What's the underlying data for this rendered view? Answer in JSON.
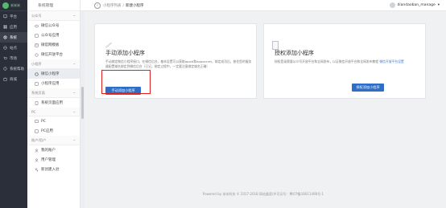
{
  "rail": {
    "logo": "米米米",
    "items": [
      {
        "label": "平台",
        "icon": "monitor-icon"
      },
      {
        "label": "应用",
        "icon": "grid-icon"
      },
      {
        "label": "系统",
        "icon": "gear-icon"
      },
      {
        "label": "站点",
        "icon": "globe-icon"
      },
      {
        "label": "市场",
        "icon": "cart-icon"
      },
      {
        "label": "系统帮助",
        "icon": "help-icon"
      },
      {
        "label": "商城",
        "icon": "shop-icon"
      }
    ]
  },
  "side": {
    "header": "系统管理",
    "groups": [
      {
        "label": "公众号",
        "items": [
          "微信公众号",
          "公众号应用",
          "微官网模板",
          "微信开放平台"
        ]
      },
      {
        "label": "小程序",
        "items": [
          "微信小程序",
          "小程序应用"
        ]
      },
      {
        "label": "系统页面",
        "items": [
          "系统页面应用"
        ]
      },
      {
        "label": "PC",
        "items": [
          "PC",
          "PC应用"
        ]
      },
      {
        "label": "账户/用户",
        "items": [
          "我的账户",
          "用户管理",
          "新创建入驻"
        ]
      }
    ]
  },
  "topbar": {
    "back": "‹",
    "crumb_parent": "小程序列表",
    "crumb_sep": "/",
    "crumb_current": "新建小程序",
    "user": "diandaoban_manage"
  },
  "cards": {
    "manual": {
      "title": "手动添加小程序",
      "desc": "手动绑定微信小程序接口，在微信后台，基本设置可以获取appid和appsecret，绑定成功后，前往您的服务器配置域名绑定到微信后台（已记，绑定过程中，一定要注意绑定域名正确）",
      "button": "手动添加小程序"
    },
    "auth": {
      "title": "授权添加小程序",
      "desc": "授权登录需要公众号开放平台和全网发布，以证微信开放平台和全网发布教程 ",
      "desc_link": "微信开放平台设置",
      "button": "授权添加小程序"
    }
  },
  "footer": "Powered by 米米科技 © 2017-2018 网站备案/许可证号：粤ICP备18011498号-1",
  "colors": {
    "accent": "#2e6ec6",
    "highlight": "#e01f1f",
    "rail": "#2b2f3a"
  }
}
